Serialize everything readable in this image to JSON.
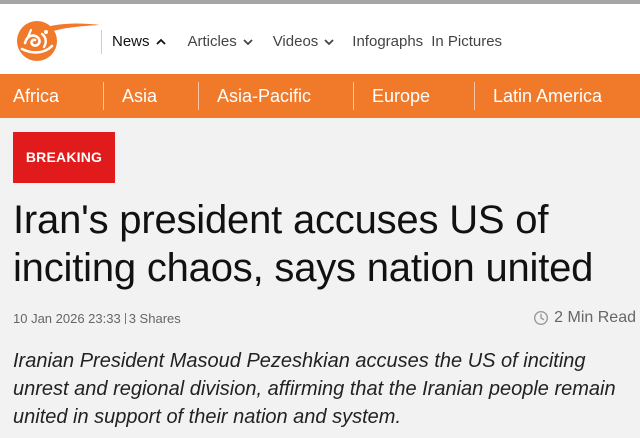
{
  "header": {
    "logo_name": "al-mayadeen-logo",
    "nav": {
      "news": "News",
      "articles": "Articles",
      "videos": "Videos",
      "infographs": "Infographs",
      "in_pictures": "In Pictures"
    }
  },
  "regions": [
    "Africa",
    "Asia",
    "Asia-Pacific",
    "Europe",
    "Latin America"
  ],
  "article": {
    "badge": "BREAKING",
    "headline": "Iran's president accuses US of inciting chaos, says nation united",
    "date": "10 Jan 2026 23:33",
    "shares": "3 Shares",
    "read_time": "2 Min Read",
    "summary": "Iranian President Masoud Pezeshkian accuses the US of inciting unrest and regional division, affirming that the Iranian people remain united in support of their nation and system."
  },
  "colors": {
    "brand_orange": "#f07a2a",
    "breaking_red": "#e11b1b",
    "top_strip": "#a5a5a5"
  },
  "icons": {
    "news_chevron": "chevron-up-icon",
    "articles_chevron": "chevron-down-icon",
    "videos_chevron": "chevron-down-icon",
    "read_time": "clock-icon"
  }
}
